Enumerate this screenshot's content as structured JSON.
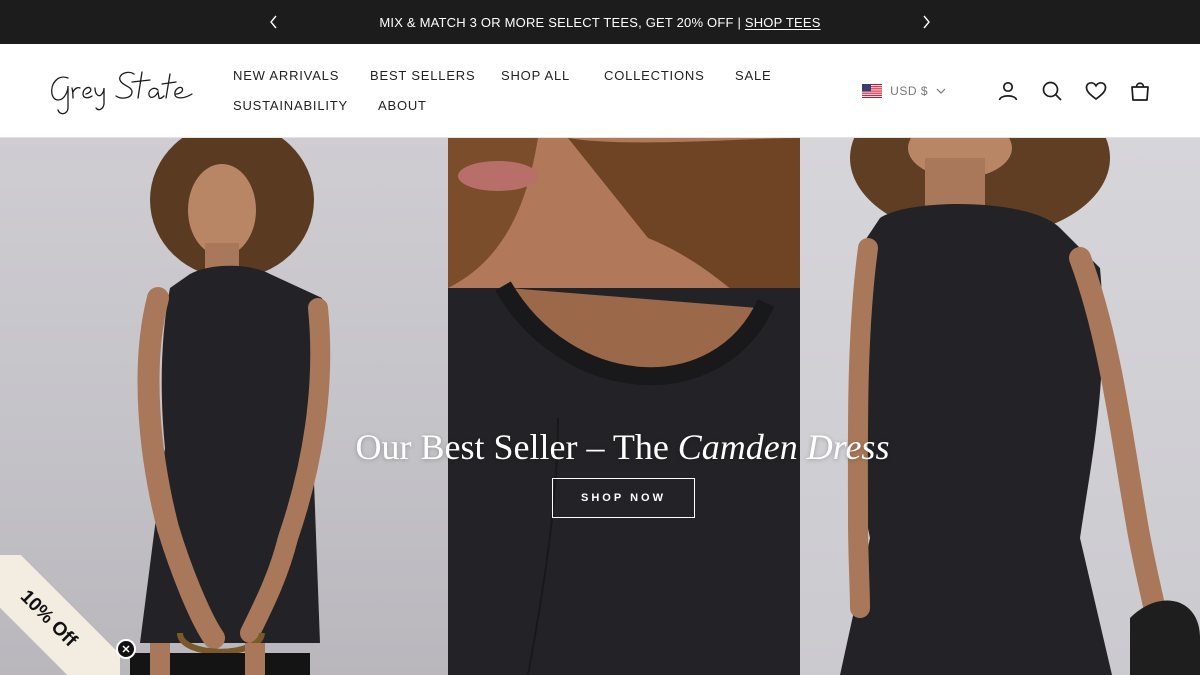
{
  "announcement": {
    "message": "MIX & MATCH 3 OR MORE SELECT TEES, GET 20% OFF | ",
    "link_label": "SHOP TEES"
  },
  "brand": {
    "name": "Grey State"
  },
  "nav": {
    "items": [
      {
        "label": "NEW ARRIVALS"
      },
      {
        "label": "BEST SELLERS"
      },
      {
        "label": "SHOP ALL"
      },
      {
        "label": "COLLECTIONS"
      },
      {
        "label": "SALE"
      },
      {
        "label": "SUSTAINABILITY"
      },
      {
        "label": "ABOUT"
      }
    ]
  },
  "header_tools": {
    "currency": "USD $",
    "icons": [
      "account-icon",
      "search-icon",
      "wishlist-icon",
      "cart-icon"
    ]
  },
  "hero": {
    "title_prefix": "Our Best Seller – The ",
    "title_emphasis": "Camden Dress",
    "cta_label": "SHOP NOW"
  },
  "promo": {
    "ribbon_label": "10% Off"
  },
  "colors": {
    "announcement_bg": "#1c1c1c",
    "ribbon_bg": "#f2ece1",
    "dress": "#232327"
  }
}
